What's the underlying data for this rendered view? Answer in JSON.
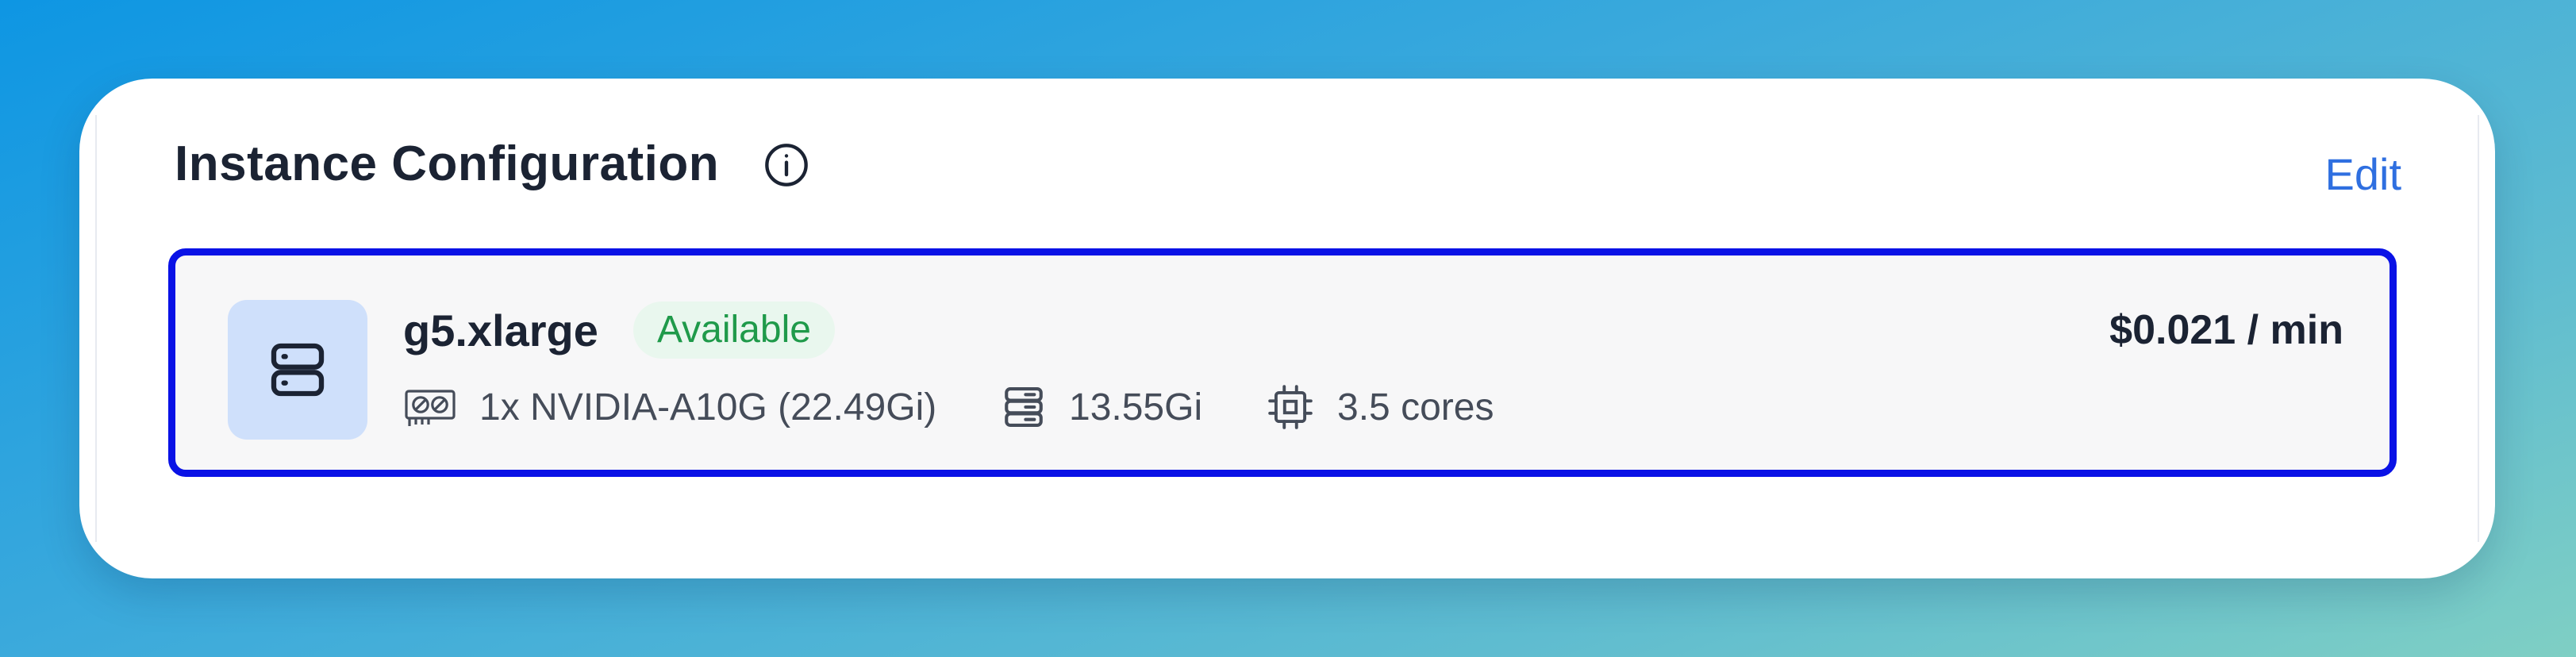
{
  "section": {
    "title": "Instance Configuration",
    "info_icon": "info-circle-icon",
    "edit_label": "Edit"
  },
  "instance": {
    "icon": "server-icon",
    "name": "g5.xlarge",
    "status": "Available",
    "price": "$0.021 / min",
    "specs": {
      "gpu": {
        "icon": "gpu-card-icon",
        "label": "1x NVIDIA-A10G (22.49Gi)"
      },
      "memory": {
        "icon": "memory-icon",
        "label": "13.55Gi"
      },
      "cpu": {
        "icon": "cpu-chip-icon",
        "label": "3.5 cores"
      }
    }
  },
  "colors": {
    "accent_link": "#2f6fe0",
    "selection_border": "#0a12e6",
    "status_green": "#1f9a4a",
    "status_bg": "#e9f7ee",
    "icon_box_bg": "#cfe0fb"
  }
}
